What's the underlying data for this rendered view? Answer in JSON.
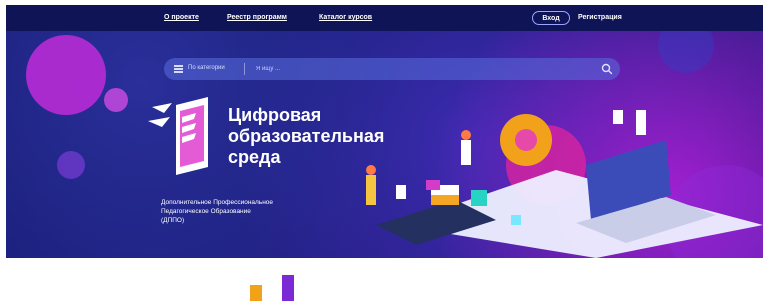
{
  "header": {
    "links": [
      "О проекте",
      "Реестр программ",
      "Каталог курсов"
    ],
    "login_label": "Вход",
    "register_label": "Регистрация"
  },
  "search": {
    "category_label": "По категории",
    "placeholder": "Я ищу ..."
  },
  "hero": {
    "title_line1": "Цифровая",
    "title_line2": "образовательная",
    "title_line3": "среда",
    "description_line1": "Дополнительное Профессиональное",
    "description_line2": "Педагогическое Образование",
    "description_line3": "(ДППО)"
  },
  "icons": [
    "menu-icon",
    "search-icon",
    "logo-icon"
  ],
  "colors": {
    "topbar": "#0e1455",
    "accent": "#9aa6ff",
    "hero_bg": "#1b1f7c",
    "magenta": "#a11fd0"
  }
}
